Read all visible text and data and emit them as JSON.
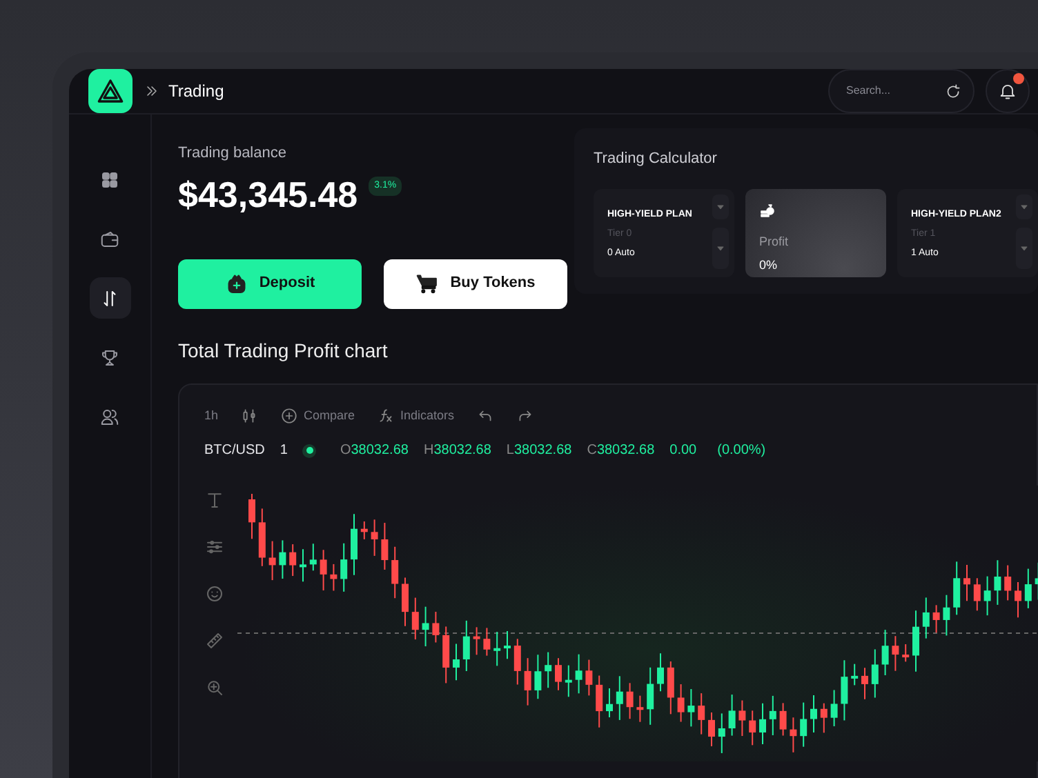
{
  "header": {
    "breadcrumb": "Trading",
    "search": {
      "placeholder": "Search..."
    },
    "notifications": {
      "unread": true
    }
  },
  "sidebar": {
    "items": [
      {
        "kind": "grid",
        "selected": false
      },
      {
        "kind": "wallet",
        "selected": false
      },
      {
        "kind": "transfer",
        "selected": true
      },
      {
        "kind": "trophy",
        "selected": false
      },
      {
        "kind": "users",
        "selected": false
      }
    ]
  },
  "balance": {
    "label": "Trading balance",
    "amount": "$43,345.48",
    "change": "3.1%"
  },
  "actions": [
    {
      "kind": "deposit",
      "label": "Deposit"
    },
    {
      "kind": "buy",
      "label": "Buy Tokens"
    }
  ],
  "calculator": {
    "title": "Trading Calculator",
    "cards": [
      {
        "kind": "plan",
        "name": "HIGH-YIELD PLAN",
        "tier": "Tier 0",
        "value": "0 Auto"
      },
      {
        "kind": "profit",
        "label": "Profit",
        "value": "0%"
      },
      {
        "kind": "plan",
        "name": "HIGH-YIELD PLAN2",
        "tier": "Tier 1",
        "value": "1 Auto"
      }
    ]
  },
  "chart": {
    "title": "Total Trading Profit chart",
    "toolbar": [
      {
        "kind": "interval",
        "label": "1h"
      },
      {
        "kind": "candles"
      },
      {
        "kind": "compare",
        "label": "Compare"
      },
      {
        "kind": "indicators",
        "label": "Indicators"
      },
      {
        "kind": "undo"
      },
      {
        "kind": "redo"
      }
    ],
    "symbol": "BTC/USD",
    "interval": "1",
    "live": true,
    "ohlc": [
      {
        "key": "O",
        "value": "38032.68"
      },
      {
        "key": "H",
        "value": "38032.68"
      },
      {
        "key": "L",
        "value": "38032.68"
      },
      {
        "key": "C",
        "value": "38032.68"
      }
    ],
    "change": "0.00",
    "change_pct": "(0.00%)",
    "tools": [
      {
        "kind": "text"
      },
      {
        "kind": "sliders"
      },
      {
        "kind": "smiley"
      },
      {
        "kind": "ruler"
      },
      {
        "kind": "zoom"
      }
    ]
  }
}
